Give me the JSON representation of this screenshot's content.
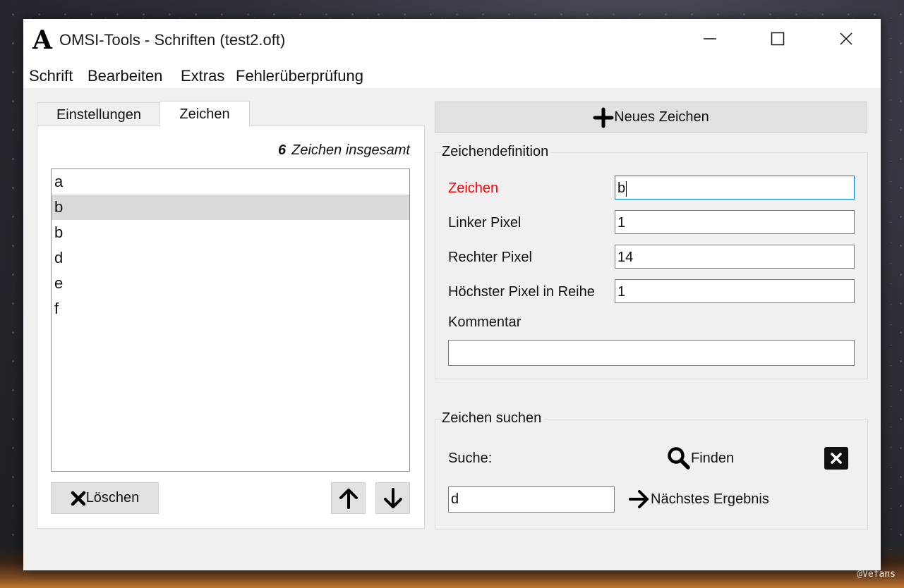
{
  "window": {
    "logo_letter": "A",
    "title": "OMSI-Tools - Schriften (test2.oft)"
  },
  "menu": [
    "Schrift",
    "Bearbeiten",
    "Extras",
    "Fehlerüberprüfung"
  ],
  "tabs": [
    {
      "label": "Einstellungen",
      "active": false
    },
    {
      "label": "Zeichen",
      "active": true
    }
  ],
  "char_panel": {
    "count": "6",
    "count_suffix": "Zeichen insgesamt",
    "items": [
      "a",
      "b",
      "b",
      "d",
      "e",
      "f"
    ],
    "selected_index": 1,
    "delete_label": "Löschen"
  },
  "new_char_label": "Neues Zeichen",
  "definition": {
    "title": "Zeichendefinition",
    "char_label": "Zeichen",
    "char_value": "b",
    "left_label": "Linker Pixel",
    "left_value": "1",
    "right_label": "Rechter Pixel",
    "right_value": "14",
    "top_label": "Höchster Pixel in Reihe",
    "top_value": "1",
    "comment_label": "Kommentar",
    "comment_value": ""
  },
  "search": {
    "title": "Zeichen suchen",
    "label": "Suche:",
    "find_label": "Finden",
    "query": "d",
    "next_label": "Nächstes Ergebnis"
  },
  "watermark": "@Vefans",
  "colors": {
    "error_label": "#ff0000",
    "focus_border": "#0078d7",
    "selection": "#d9d9d9"
  }
}
